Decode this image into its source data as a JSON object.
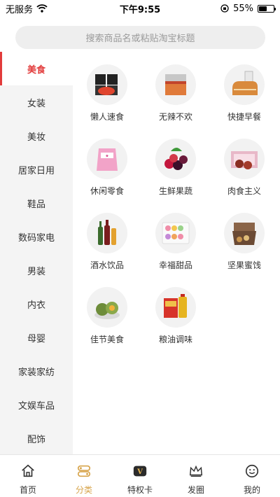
{
  "status": {
    "carrier": "无服务",
    "time": "下午9:55",
    "battery": "55%",
    "battery_level": 0.55
  },
  "search": {
    "placeholder": "搜索商品名或粘贴淘宝标题"
  },
  "sidebar": {
    "items": [
      {
        "label": "美食",
        "active": true
      },
      {
        "label": "女装"
      },
      {
        "label": "美妆"
      },
      {
        "label": "居家日用"
      },
      {
        "label": "鞋品"
      },
      {
        "label": "数码家电"
      },
      {
        "label": "男装"
      },
      {
        "label": "内衣"
      },
      {
        "label": "母婴"
      },
      {
        "label": "家装家纺"
      },
      {
        "label": "文娱车品"
      },
      {
        "label": "配饰"
      }
    ]
  },
  "categories": [
    {
      "label": "懒人速食",
      "icon": "instant-noodle-icon"
    },
    {
      "label": "无辣不欢",
      "icon": "spicy-snack-icon"
    },
    {
      "label": "快捷早餐",
      "icon": "bread-milk-icon"
    },
    {
      "label": "休闲零食",
      "icon": "snack-bag-icon"
    },
    {
      "label": "生鲜果蔬",
      "icon": "berries-icon"
    },
    {
      "label": "肉食主义",
      "icon": "meat-box-icon"
    },
    {
      "label": "酒水饮品",
      "icon": "bottles-icon"
    },
    {
      "label": "幸福甜品",
      "icon": "macaron-icon"
    },
    {
      "label": "坚果蜜饯",
      "icon": "nut-box-icon"
    },
    {
      "label": "佳节美食",
      "icon": "mooncake-icon"
    },
    {
      "label": "粮油调味",
      "icon": "oil-rice-icon"
    }
  ],
  "tabbar": {
    "items": [
      {
        "label": "首页",
        "icon": "home-icon"
      },
      {
        "label": "分类",
        "icon": "category-icon",
        "active": true
      },
      {
        "label": "特权卡",
        "icon": "vip-card-icon"
      },
      {
        "label": "发圈",
        "icon": "crown-icon"
      },
      {
        "label": "我的",
        "icon": "smile-icon"
      }
    ]
  },
  "colors": {
    "accent": "#e23b3b",
    "tab_active": "#d7a44b",
    "sidebar_bg": "#f4f4f4"
  }
}
